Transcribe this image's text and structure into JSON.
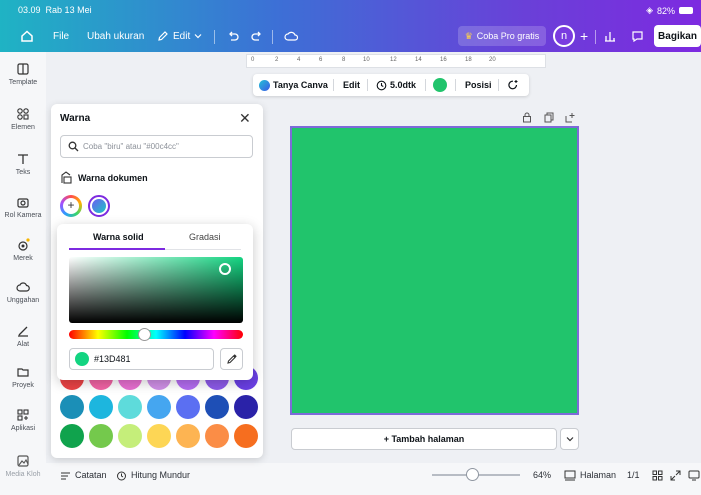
{
  "status": {
    "time": "03.09",
    "date": "Rab 13 Mei",
    "battery": "82%"
  },
  "menu": {
    "file": "File",
    "resize": "Ubah ukuran",
    "edit": "Edit",
    "try_pro": "Coba Pro gratis",
    "avatar_initial": "n",
    "share": "Bagikan"
  },
  "ruler": [
    "0",
    "2",
    "4",
    "6",
    "8",
    "10",
    "12",
    "14",
    "16",
    "18",
    "20"
  ],
  "rail": [
    {
      "label": "Template",
      "icon": "template-icon"
    },
    {
      "label": "Elemen",
      "icon": "elements-icon"
    },
    {
      "label": "Teks",
      "icon": "text-icon"
    },
    {
      "label": "Rol Kamera",
      "icon": "camera-roll-icon"
    },
    {
      "label": "Merek",
      "icon": "brand-icon"
    },
    {
      "label": "Unggahan",
      "icon": "uploads-icon"
    },
    {
      "label": "Alat",
      "icon": "tools-icon"
    },
    {
      "label": "Proyek",
      "icon": "projects-icon"
    },
    {
      "label": "Aplikasi",
      "icon": "apps-icon"
    },
    {
      "label": "Media Kloh",
      "icon": "media-icon"
    }
  ],
  "toolbar": {
    "ask_canva": "Tanya Canva",
    "edit": "Edit",
    "duration": "5.0dtk",
    "position": "Posisi",
    "current_color": "#21c46c"
  },
  "canvas": {
    "page_color": "#21c46c",
    "add_page": "+ Tambah halaman"
  },
  "bottom": {
    "notes": "Catatan",
    "countdown": "Hitung Mundur",
    "zoom": "64%",
    "pages_label": "Halaman",
    "pages": "1/1",
    "zoom_level": 0.45
  },
  "panel": {
    "title": "Warna",
    "search_placeholder": "Coba \"biru\" atau \"#00c4cc\"",
    "doc_colors_title": "Warna dokumen",
    "palette": [
      [
        "#ea4345",
        "#f163a4",
        "#e76fd0",
        "#cf8fe6",
        "#b36cf0",
        "#8c5ae8",
        "#6a3fe4"
      ],
      [
        "#1b8fb7",
        "#1db6de",
        "#5edbdb",
        "#45a6f0",
        "#5b6ff2",
        "#1e4fb6",
        "#2a22a8"
      ],
      [
        "#10a34d",
        "#74c94c",
        "#c5ee7a",
        "#fdd655",
        "#fdb452",
        "#fb8d46",
        "#f66e1f"
      ]
    ]
  },
  "picker": {
    "tab_solid": "Warna solid",
    "tab_gradient": "Gradasi",
    "hex_value": "#13D481",
    "hex_color": "#13d481",
    "hue_position": 0.43
  },
  "colors": {
    "accent": "#7d2ae0",
    "canvas_green": "#21c46c"
  }
}
